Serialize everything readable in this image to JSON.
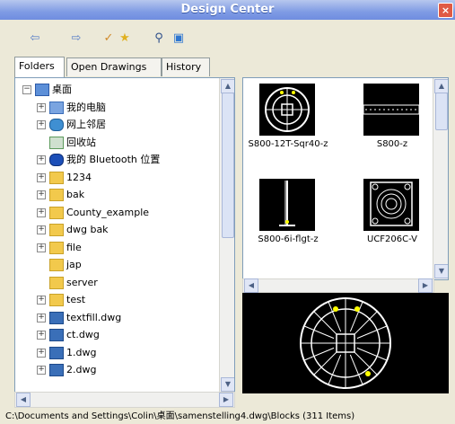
{
  "window": {
    "title": "Design Center"
  },
  "tabs": [
    {
      "label": "Folders",
      "active": true
    },
    {
      "label": "Open Drawings",
      "active": false
    },
    {
      "label": "History",
      "active": false
    }
  ],
  "toolbar": {
    "icons": [
      "back-icon",
      "forward-icon",
      "up-icon",
      "favorites-icon",
      "search-icon",
      "view-icon"
    ]
  },
  "tree": {
    "items": [
      {
        "label": "桌面",
        "icon": "desktop-icon",
        "expander": "minus",
        "indent": 0
      },
      {
        "label": "我的电脑",
        "icon": "computer-icon",
        "expander": "plus",
        "indent": 1
      },
      {
        "label": "网上邻居",
        "icon": "network-icon",
        "expander": "plus",
        "indent": 1
      },
      {
        "label": "回收站",
        "icon": "recycle-bin-icon",
        "expander": "",
        "indent": 1
      },
      {
        "label": "我的 Bluetooth 位置",
        "icon": "bluetooth-icon",
        "expander": "plus",
        "indent": 1
      },
      {
        "label": "1234",
        "icon": "folder-icon",
        "expander": "plus",
        "indent": 1
      },
      {
        "label": "bak",
        "icon": "folder-icon",
        "expander": "plus",
        "indent": 1
      },
      {
        "label": "County_example",
        "icon": "folder-icon",
        "expander": "plus",
        "indent": 1
      },
      {
        "label": "dwg bak",
        "icon": "folder-icon",
        "expander": "plus",
        "indent": 1
      },
      {
        "label": "file",
        "icon": "folder-icon",
        "expander": "plus",
        "indent": 1
      },
      {
        "label": "jap",
        "icon": "folder-icon",
        "expander": "",
        "indent": 1
      },
      {
        "label": "server",
        "icon": "folder-icon",
        "expander": "",
        "indent": 1
      },
      {
        "label": "test",
        "icon": "folder-icon",
        "expander": "plus",
        "indent": 1
      },
      {
        "label": "textfill.dwg",
        "icon": "dwg-file-icon",
        "expander": "plus",
        "indent": 1
      },
      {
        "label": "ct.dwg",
        "icon": "dwg-file-icon",
        "expander": "plus",
        "indent": 1
      },
      {
        "label": "1.dwg",
        "icon": "dwg-file-icon",
        "expander": "plus",
        "indent": 1
      },
      {
        "label": "2.dwg",
        "icon": "dwg-file-icon",
        "expander": "plus",
        "indent": 1
      }
    ]
  },
  "blocks": [
    {
      "name": "S800-12T-Sqr40-z"
    },
    {
      "name": "S800-z"
    },
    {
      "name": "S800-6i-flgt-z"
    },
    {
      "name": "UCF206C-V"
    }
  ],
  "status": {
    "text": "C:\\Documents and Settings\\Colin\\桌面\\samenstelling4.dwg\\Blocks (311 Items)"
  }
}
